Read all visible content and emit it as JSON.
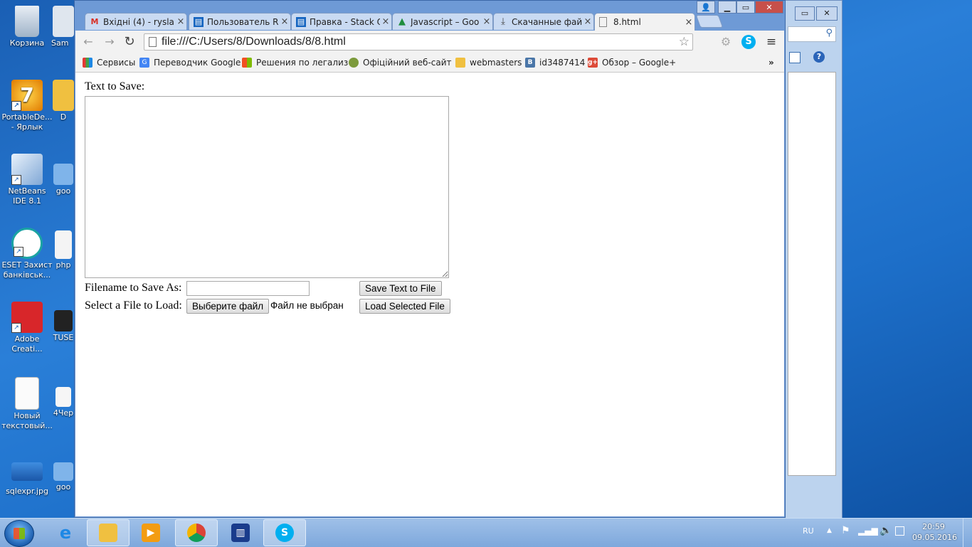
{
  "desktop": {
    "icons": [
      {
        "label": "Корзина"
      },
      {
        "label": "Sam"
      },
      {
        "label": "PortableDe... - Ярлык"
      },
      {
        "label": "D"
      },
      {
        "label": "NetBeans IDE 8.1"
      },
      {
        "label": "goo"
      },
      {
        "label": "ESET Захист банківськ..."
      },
      {
        "label": "php"
      },
      {
        "label": "Adobe Creati..."
      },
      {
        "label": "TUSE"
      },
      {
        "label": "Новый текстовый..."
      },
      {
        "label": "4Чер"
      },
      {
        "label": "sqlexpr.jpg"
      },
      {
        "label": "goo"
      }
    ]
  },
  "browser": {
    "tabs": [
      {
        "title": "Вхідні (4) - rysla",
        "icon": "gmail-icon",
        "color": "#d93025"
      },
      {
        "title": "Пользователь R",
        "icon": "stackoverflow-icon",
        "color": "#1565c0"
      },
      {
        "title": "Правка - Stack O",
        "icon": "stackoverflow-icon",
        "color": "#1565c0"
      },
      {
        "title": "Javascript – Goo",
        "icon": "google-drive-icon",
        "color": "#1e8e3e"
      },
      {
        "title": "Скачанные фай",
        "icon": "download-icon",
        "color": "#444444"
      },
      {
        "title": "8.html",
        "icon": "page-icon",
        "color": "#888888"
      }
    ],
    "address": "file:///C:/Users/8/Downloads/8/8.html",
    "bookmarks": [
      {
        "label": "Сервисы",
        "icon": "apps-icon",
        "color": "#e53935"
      },
      {
        "label": "Переводчик Google",
        "icon": "google-translate-icon",
        "color": "#4285f4"
      },
      {
        "label": "Решения по легализ",
        "icon": "windows-icon",
        "color": "#f25022"
      },
      {
        "label": "Офіційний веб-сайт",
        "icon": "globe-icon",
        "color": "#7c9a3c"
      },
      {
        "label": "webmasters",
        "icon": "folder-icon",
        "color": "#f0c040"
      },
      {
        "label": "id3487414",
        "icon": "vk-icon",
        "color": "#4a76a8"
      },
      {
        "label": "Обзор – Google+",
        "icon": "google-plus-icon",
        "color": "#dd4b39"
      }
    ],
    "more_bookmarks": "»"
  },
  "page": {
    "text_to_save_label": "Text to Save:",
    "filename_label": "Filename to Save As:",
    "filename_value": "",
    "save_button": "Save Text to File",
    "load_label": "Select a File to Load:",
    "choose_file_button": "Выберите файл",
    "no_file_text": "Файл не выбран",
    "load_button": "Load Selected File"
  },
  "taskbar": {
    "language": "RU",
    "time": "20:59",
    "date": "09.05.2016"
  }
}
